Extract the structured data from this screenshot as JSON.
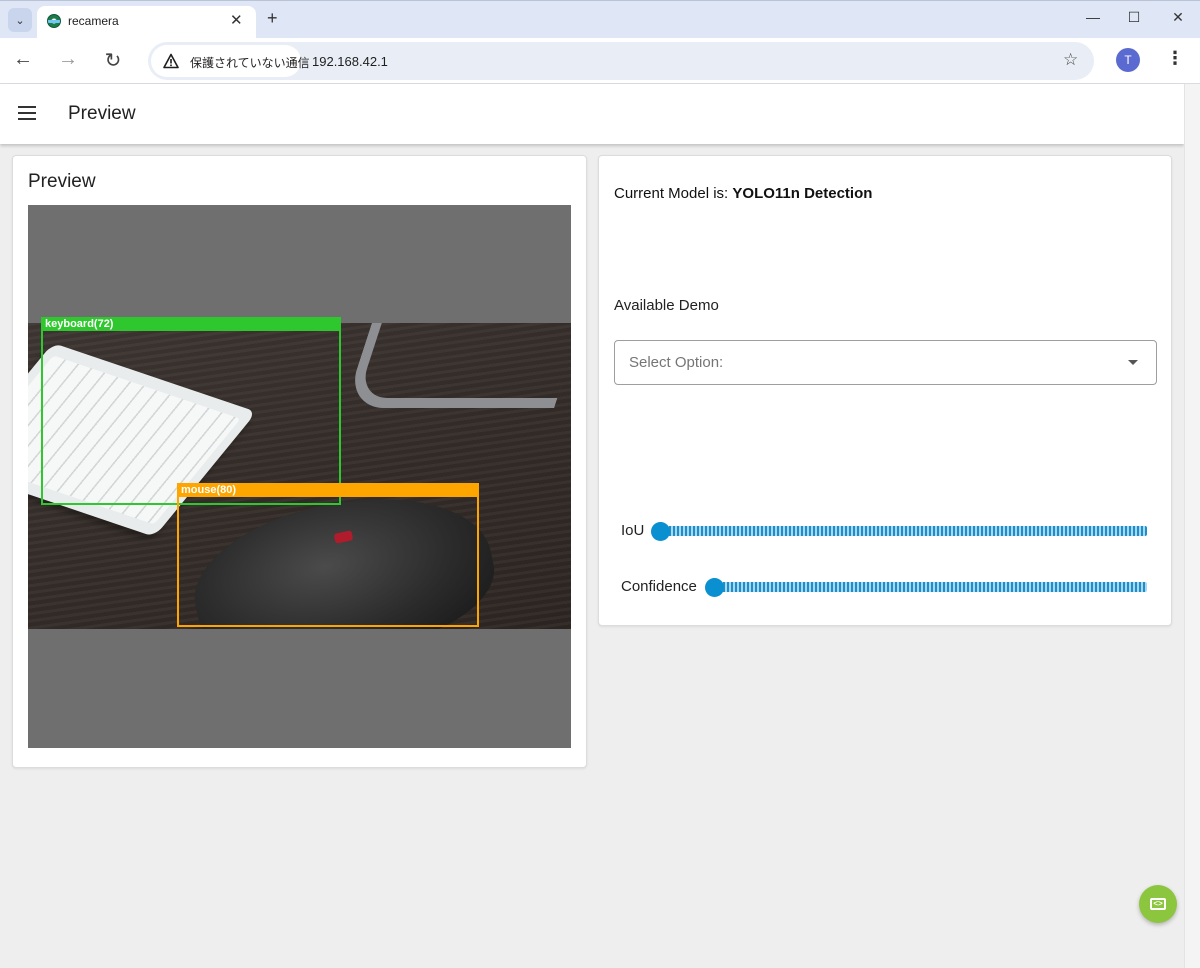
{
  "browser": {
    "tab_title": "recamera",
    "security_chip": "保護されていない通信",
    "url": "192.168.42.1",
    "profile_initial": "T",
    "tab_search_glyph": "⌄",
    "new_tab_glyph": "+",
    "close_tab_glyph": "✕",
    "minimize_glyph": "—",
    "maximize_glyph": "☐",
    "close_window_glyph": "✕",
    "back_glyph": "←",
    "forward_glyph": "→",
    "reload_glyph": "↻",
    "star_glyph": "☆",
    "menu_glyph": "⋮"
  },
  "app": {
    "header_title": "Preview"
  },
  "preview": {
    "title": "Preview",
    "detections": [
      {
        "label": "keyboard(72)",
        "color": "#2ec82e"
      },
      {
        "label": "mouse(80)",
        "color": "#ffa500"
      }
    ]
  },
  "controls": {
    "model_prefix": "Current Model is:",
    "model_name": "YOLO11n Detection",
    "demo_label": "Available Demo",
    "select_placeholder": "Select Option:",
    "sliders": [
      {
        "label": "IoU",
        "value": 0
      },
      {
        "label": "Confidence",
        "value": 0
      }
    ]
  },
  "colors": {
    "accent": "#0a8fd1",
    "fab": "#8cc63f"
  },
  "icons": {
    "fab": "code-window-icon"
  }
}
